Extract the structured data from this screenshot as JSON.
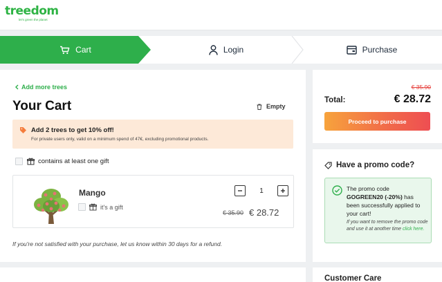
{
  "brand": {
    "name": "treedom",
    "tagline": "let's green the planet"
  },
  "steps": [
    {
      "label": "Cart",
      "active": true
    },
    {
      "label": "Login",
      "active": false
    },
    {
      "label": "Purchase",
      "active": false
    }
  ],
  "cart": {
    "add_more": "Add more trees",
    "title": "Your Cart",
    "empty_label": "Empty",
    "banner": {
      "title": "Add 2 trees to get 10% off!",
      "subtitle": "For private users only, valid on a minimum spend of 47€, excluding promotional products."
    },
    "gift_option": "contains at least one gift",
    "item": {
      "name": "Mango",
      "gift_label": "it's a gift",
      "quantity": "1",
      "old_price": "€ 35.90",
      "new_price": "€ 28.72"
    },
    "refund_note": "If you're not satisfied with your purchase, let us know within 30 days for a refund."
  },
  "summary": {
    "old_total": "€ 35.90",
    "total_label": "Total:",
    "total": "€ 28.72",
    "proceed": "Proceed to purchase"
  },
  "promo": {
    "heading": "Have a promo code?",
    "line1": "The promo code",
    "code": "GOGREEN20 (-20%)",
    "line2": "has been successfully applied to your cart!",
    "note": "If you want to remove the promo code and use it at another time",
    "link": "click here."
  },
  "care": {
    "title": "Customer Care"
  },
  "colors": {
    "brand_green": "#2eaf4b",
    "accent_orange": "#f7a33c",
    "accent_red": "#ee4e52",
    "strike_red": "#e53935"
  }
}
